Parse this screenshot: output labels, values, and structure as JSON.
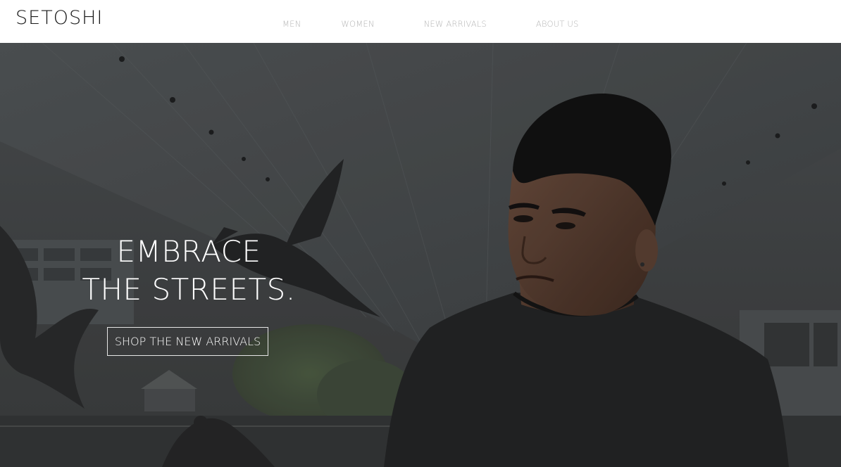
{
  "header": {
    "brand": "SETOSHI",
    "nav": [
      {
        "label": "MEN"
      },
      {
        "label": "WOMEN"
      },
      {
        "label": "NEW ARRIVALS"
      },
      {
        "label": "ABOUT US"
      }
    ]
  },
  "hero": {
    "heading_line1": "EMBRACE",
    "heading_line2": "THE STREETS.",
    "cta_label": "SHOP THE NEW ARRIVALS",
    "photo_subject": "man in dark t-shirt under overpass with flying pigeons"
  },
  "colors": {
    "header_bg": "#ffffff",
    "brand_text": "#1a1a1a",
    "nav_text": "#b4b4b4",
    "hero_overlay": "#3d3f40",
    "hero_text": "#ffffff",
    "cta_border": "#e6e6e6"
  }
}
